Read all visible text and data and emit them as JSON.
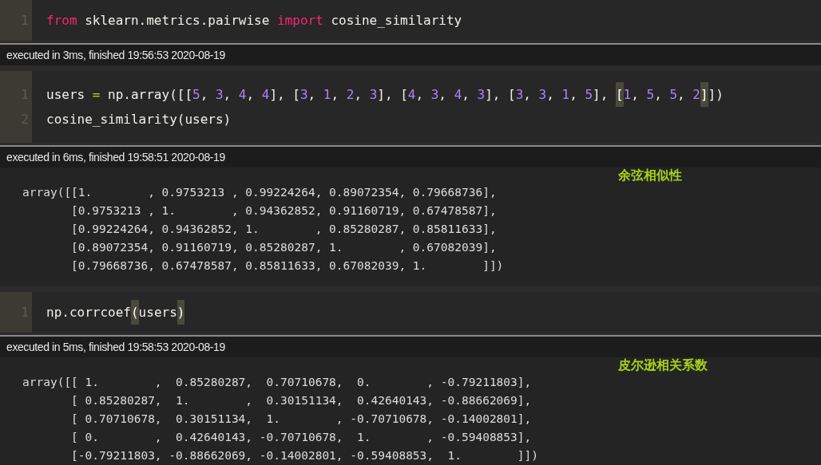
{
  "cells": [
    {
      "lines": [
        {
          "number": "1",
          "tokens": [
            {
              "text": "from",
              "kind": "keyword"
            },
            {
              "text": " sklearn.metrics.pairwise ",
              "kind": "plain"
            },
            {
              "text": "import",
              "kind": "keyword"
            },
            {
              "text": " cosine_similarity",
              "kind": "plain"
            }
          ]
        }
      ],
      "status": "executed in 3ms, finished 19:56:53 2020-08-19"
    },
    {
      "lines": [
        {
          "number": "1",
          "tokens": [
            {
              "text": "users ",
              "kind": "plain"
            },
            {
              "text": "=",
              "kind": "operator"
            },
            {
              "text": " np.array([[",
              "kind": "plain"
            },
            {
              "text": "5",
              "kind": "number"
            },
            {
              "text": ", ",
              "kind": "plain"
            },
            {
              "text": "3",
              "kind": "number"
            },
            {
              "text": ", ",
              "kind": "plain"
            },
            {
              "text": "4",
              "kind": "number"
            },
            {
              "text": ", ",
              "kind": "plain"
            },
            {
              "text": "4",
              "kind": "number"
            },
            {
              "text": "], [",
              "kind": "plain"
            },
            {
              "text": "3",
              "kind": "number"
            },
            {
              "text": ", ",
              "kind": "plain"
            },
            {
              "text": "1",
              "kind": "number"
            },
            {
              "text": ", ",
              "kind": "plain"
            },
            {
              "text": "2",
              "kind": "number"
            },
            {
              "text": ", ",
              "kind": "plain"
            },
            {
              "text": "3",
              "kind": "number"
            },
            {
              "text": "], [",
              "kind": "plain"
            },
            {
              "text": "4",
              "kind": "number"
            },
            {
              "text": ", ",
              "kind": "plain"
            },
            {
              "text": "3",
              "kind": "number"
            },
            {
              "text": ", ",
              "kind": "plain"
            },
            {
              "text": "4",
              "kind": "number"
            },
            {
              "text": ", ",
              "kind": "plain"
            },
            {
              "text": "3",
              "kind": "number"
            },
            {
              "text": "], [",
              "kind": "plain"
            },
            {
              "text": "3",
              "kind": "number"
            },
            {
              "text": ", ",
              "kind": "plain"
            },
            {
              "text": "3",
              "kind": "number"
            },
            {
              "text": ", ",
              "kind": "plain"
            },
            {
              "text": "1",
              "kind": "number"
            },
            {
              "text": ", ",
              "kind": "plain"
            },
            {
              "text": "5",
              "kind": "number"
            },
            {
              "text": "], ",
              "kind": "plain"
            },
            {
              "text": "[",
              "kind": "match"
            },
            {
              "text": "1",
              "kind": "number"
            },
            {
              "text": ", ",
              "kind": "plain"
            },
            {
              "text": "5",
              "kind": "number"
            },
            {
              "text": ", ",
              "kind": "plain"
            },
            {
              "text": "5",
              "kind": "number"
            },
            {
              "text": ", ",
              "kind": "plain"
            },
            {
              "text": "2",
              "kind": "number"
            },
            {
              "text": "]",
              "kind": "match"
            },
            {
              "text": "])",
              "kind": "plain"
            }
          ]
        },
        {
          "number": "2",
          "tokens": [
            {
              "text": "cosine_similarity(users)",
              "kind": "plain"
            }
          ]
        }
      ],
      "status": "executed in 6ms, finished 19:58:51 2020-08-19",
      "output": {
        "note": "余弦相似性",
        "lines": [
          "array([[1.        , 0.9753213 , 0.99224264, 0.89072354, 0.79668736],",
          "       [0.9753213 , 1.        , 0.94362852, 0.91160719, 0.67478587],",
          "       [0.99224264, 0.94362852, 1.        , 0.85280287, 0.85811633],",
          "       [0.89072354, 0.91160719, 0.85280287, 1.        , 0.67082039],",
          "       [0.79668736, 0.67478587, 0.85811633, 0.67082039, 1.        ]])"
        ]
      }
    },
    {
      "lines": [
        {
          "number": "1",
          "tokens": [
            {
              "text": "np.corrcoef",
              "kind": "plain"
            },
            {
              "text": "(",
              "kind": "match"
            },
            {
              "text": "users",
              "kind": "plain"
            },
            {
              "text": ")",
              "kind": "match"
            }
          ]
        }
      ],
      "status": "executed in 5ms, finished 19:58:53 2020-08-19",
      "output": {
        "note": "皮尔逊相关系数",
        "lines": [
          "array([[ 1.        ,  0.85280287,  0.70710678,  0.        , -0.79211803],",
          "       [ 0.85280287,  1.        ,  0.30151134,  0.42640143, -0.88662069],",
          "       [ 0.70710678,  0.30151134,  1.        , -0.70710678, -0.14002801],",
          "       [ 0.        ,  0.42640143, -0.70710678,  1.        , -0.59408853],",
          "       [-0.79211803, -0.88662069, -0.14002801, -0.59408853,  1.        ]])"
        ]
      }
    }
  ]
}
